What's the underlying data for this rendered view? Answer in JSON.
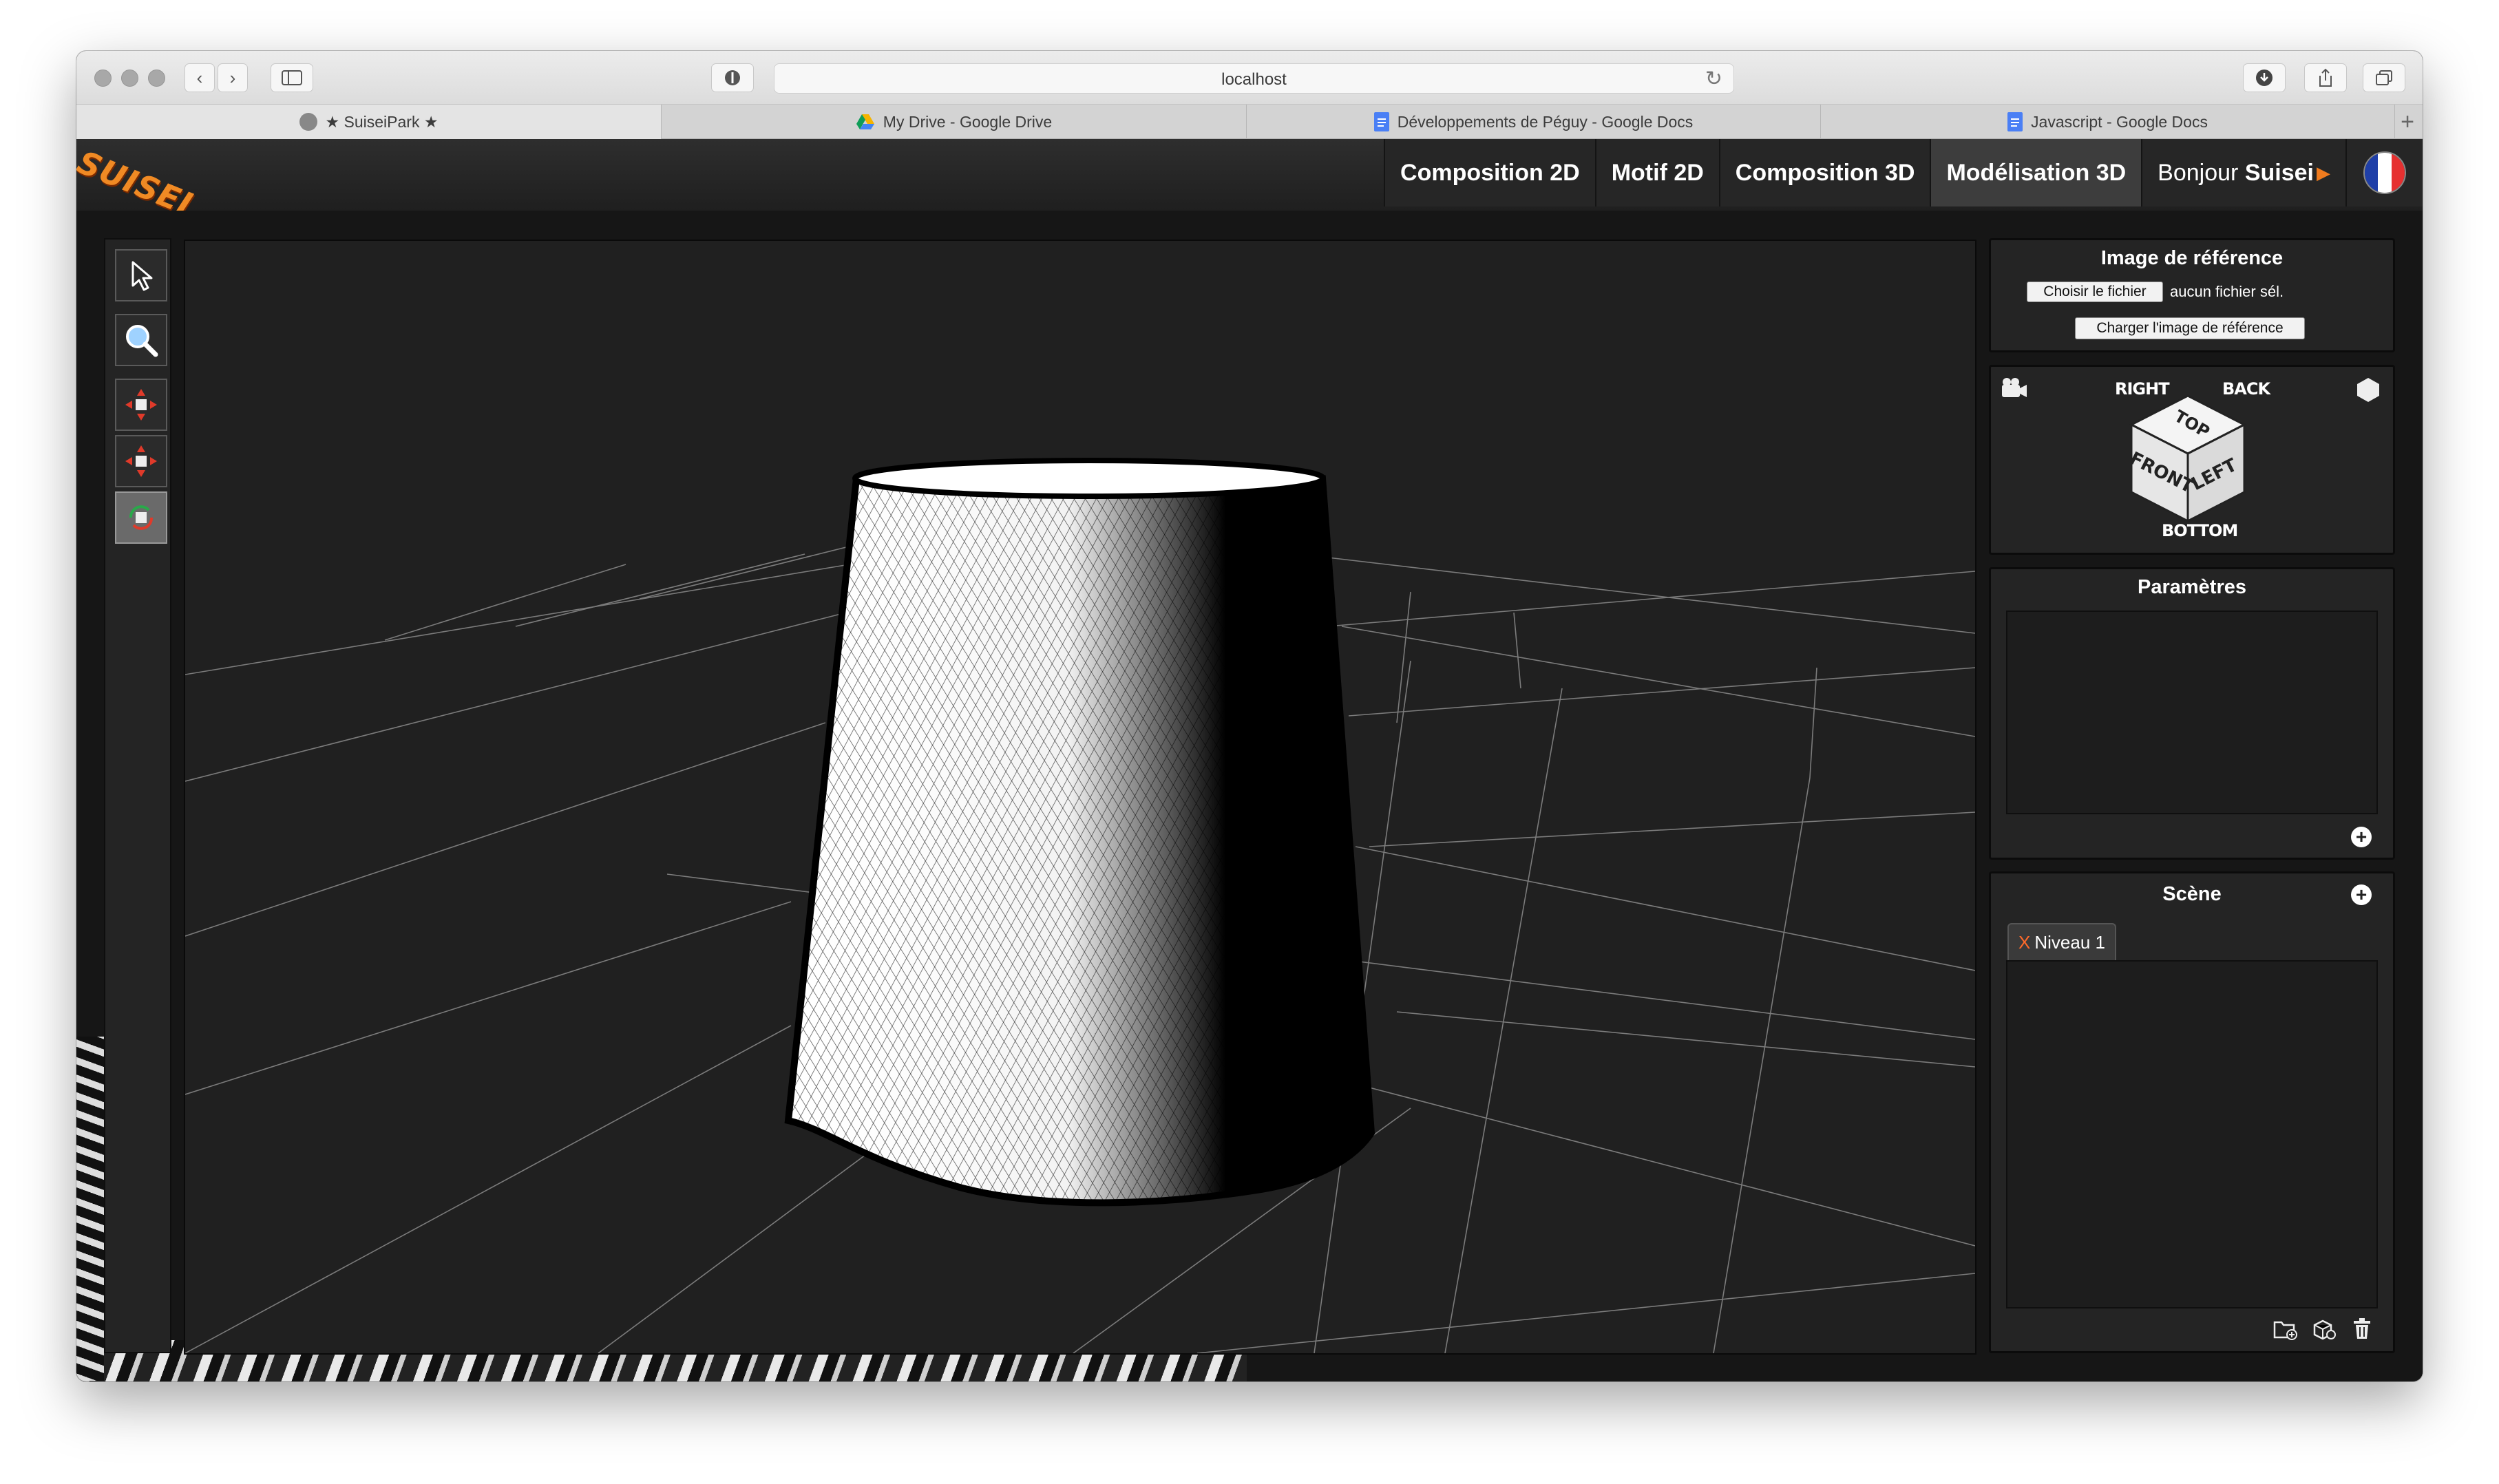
{
  "browser": {
    "url": "localhost",
    "tabs": [
      {
        "label": "★ SuiseiPark ★",
        "active": true
      },
      {
        "label": "My Drive - Google Drive",
        "active": false
      },
      {
        "label": "Développements de Péguy - Google Docs",
        "active": false
      },
      {
        "label": "Javascript - Google Docs",
        "active": false
      }
    ],
    "new_tab": "+"
  },
  "app": {
    "logo": "SUISEI",
    "nav": [
      {
        "label": "Composition 2D",
        "active": false
      },
      {
        "label": "Motif 2D",
        "active": false
      },
      {
        "label": "Composition 3D",
        "active": false
      },
      {
        "label": "Modélisation 3D",
        "active": true
      }
    ],
    "greeting_prefix": "Bonjour ",
    "greeting_user": "Suisei",
    "flag_colors": [
      "#1f3fa8",
      "#ffffff",
      "#e63030"
    ]
  },
  "tools": [
    {
      "name": "select-tool",
      "icon": "pointer-icon",
      "glyph": "⬉",
      "active": false
    },
    {
      "name": "zoom-tool",
      "icon": "magnifier-icon",
      "glyph": "🔍",
      "active": false
    },
    {
      "name": "move-tool",
      "icon": "move-arrows-icon",
      "glyph": "✥",
      "active": false
    },
    {
      "name": "scale-tool",
      "icon": "scale-arrows-icon",
      "glyph": "✥",
      "active": false
    },
    {
      "name": "rotate-tool",
      "icon": "rotate-arrows-icon",
      "glyph": "⟲",
      "active": true
    }
  ],
  "reference_panel": {
    "title": "Image de référence",
    "choose_file_label": "Choisir le fichier",
    "no_file_text": "aucun fichier sél.",
    "load_button_label": "Charger l'image de référence"
  },
  "view_cube": {
    "right": "RIGHT",
    "back": "BACK",
    "top": "TOP",
    "front": "FRONT",
    "left": "LEFT",
    "bottom": "BOTTOM",
    "camera_icon": "camera-icon",
    "ortho_icon": "hexagon-icon"
  },
  "params_panel": {
    "title": "Paramètres",
    "add_icon": "plus-circle-icon"
  },
  "scene_panel": {
    "title": "Scène",
    "add_icon": "plus-circle-icon",
    "levels": [
      {
        "remove": "X",
        "label": "Niveau 1"
      }
    ],
    "footer_icons": [
      "add-folder-icon",
      "add-object-icon",
      "trash-icon"
    ]
  },
  "colors": {
    "accent": "#f07b1e",
    "panel_bg": "#242424",
    "viewport_bg": "#202020"
  }
}
